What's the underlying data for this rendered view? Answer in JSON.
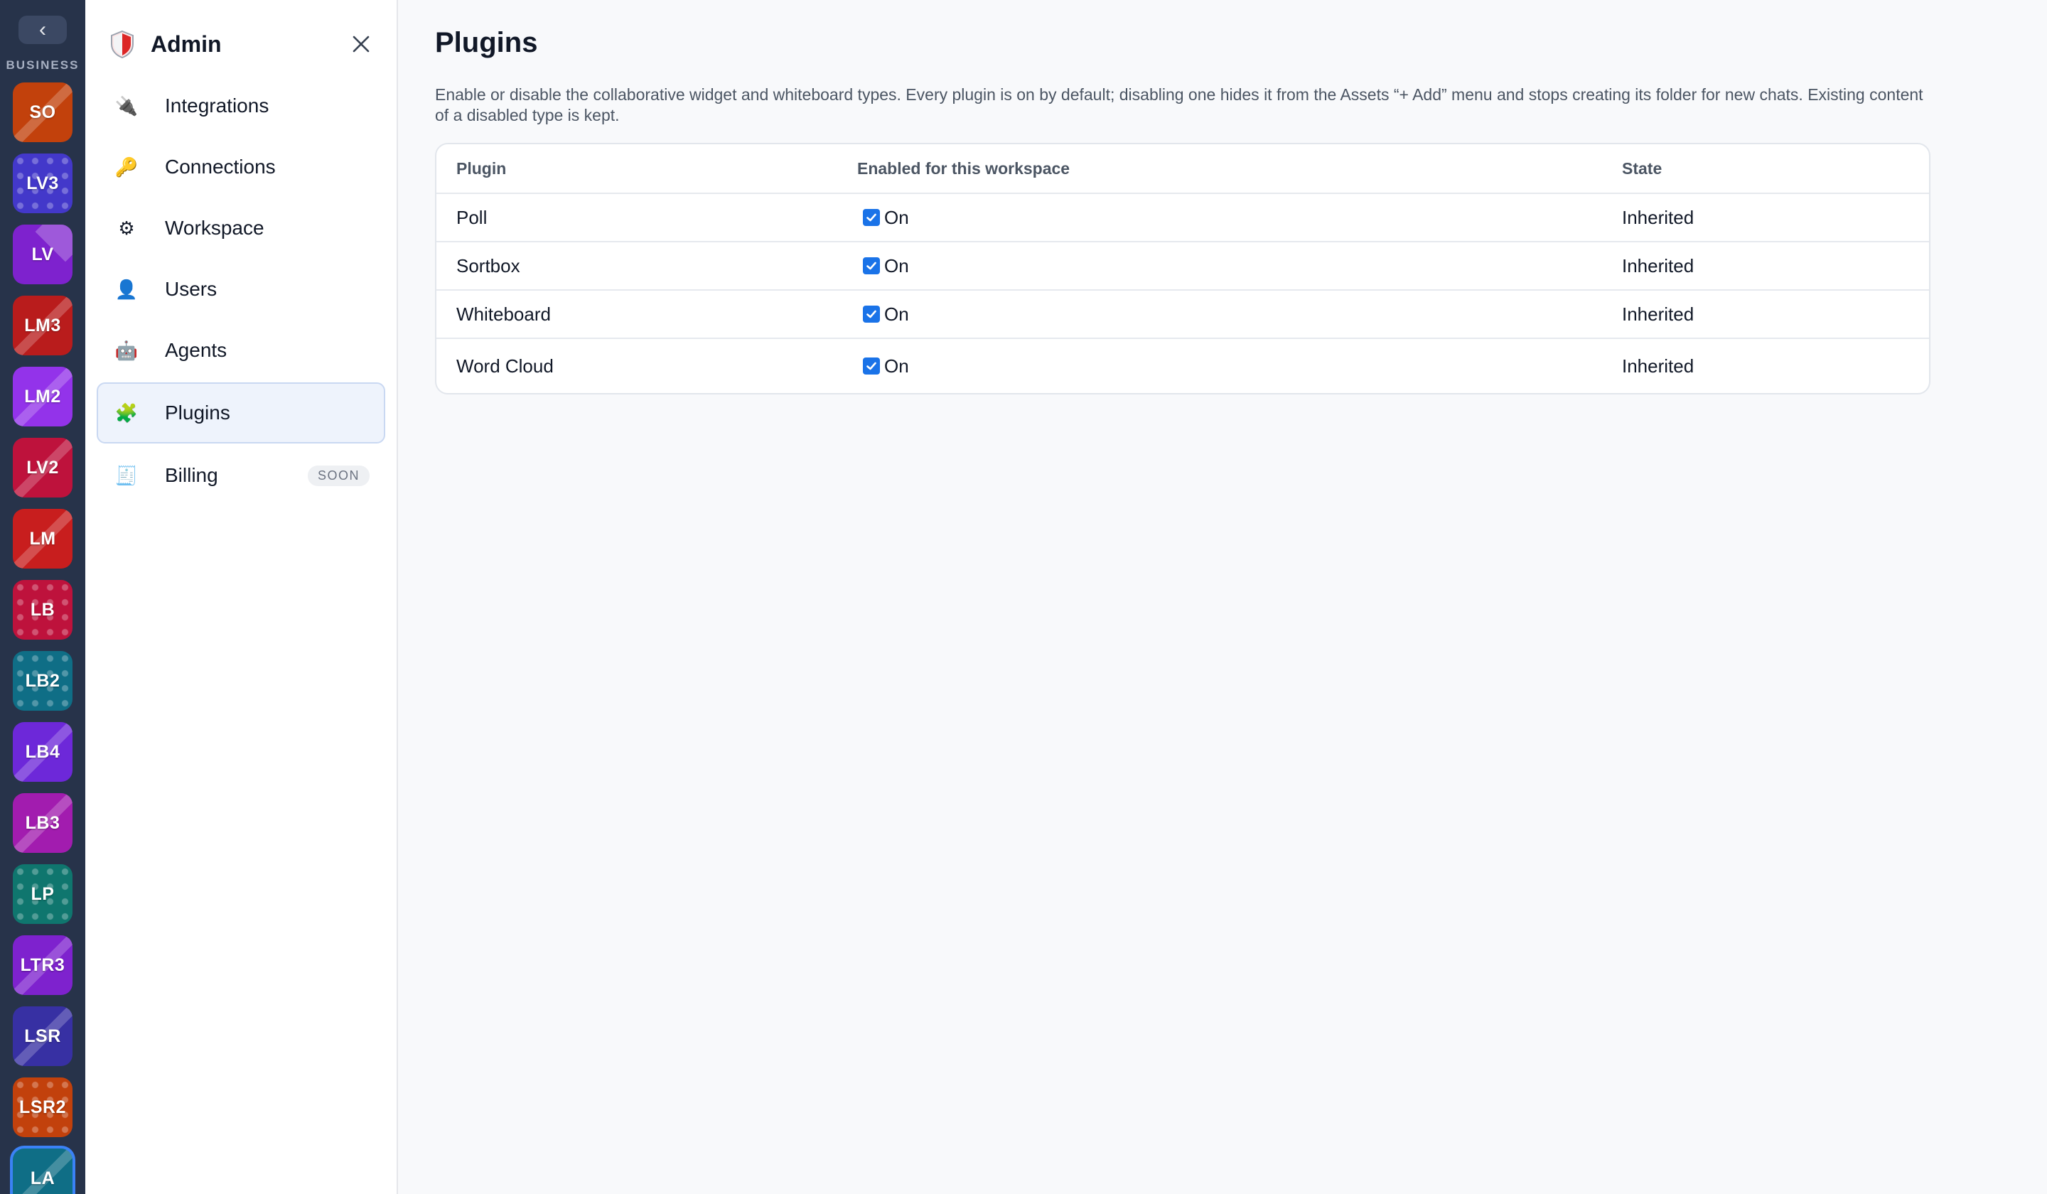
{
  "rail": {
    "back_glyph": "‹",
    "section_label": "BUSINESS",
    "workspaces": [
      {
        "initials": "SO",
        "color": "#c2410c",
        "pattern": "stripe"
      },
      {
        "initials": "LV3",
        "color": "#4338ca",
        "pattern": "dots"
      },
      {
        "initials": "LV",
        "color": "#7e22ce",
        "pattern": "corner"
      },
      {
        "initials": "LM3",
        "color": "#b91c1c",
        "pattern": "stripe"
      },
      {
        "initials": "LM2",
        "color": "#9333ea",
        "pattern": "stripe"
      },
      {
        "initials": "LV2",
        "color": "#be123c",
        "pattern": "stripe"
      },
      {
        "initials": "LM",
        "color": "#c81e1e",
        "pattern": "stripe"
      },
      {
        "initials": "LB",
        "color": "#be123c",
        "pattern": "dots"
      },
      {
        "initials": "LB2",
        "color": "#0f6e86",
        "pattern": "dots"
      },
      {
        "initials": "LB4",
        "color": "#6d28d9",
        "pattern": "stripe"
      },
      {
        "initials": "LB3",
        "color": "#a21caf",
        "pattern": "stripe"
      },
      {
        "initials": "LP",
        "color": "#0f766e",
        "pattern": "dots"
      },
      {
        "initials": "LTR3",
        "color": "#7e22ce",
        "pattern": "stripe"
      },
      {
        "initials": "LSR",
        "color": "#3730a3",
        "pattern": "stripe"
      },
      {
        "initials": "LSR2",
        "color": "#c2410c",
        "pattern": "dots"
      },
      {
        "initials": "LA",
        "color": "#0f6e86",
        "pattern": "stripe",
        "active": true
      }
    ]
  },
  "admin": {
    "title": "Admin",
    "logo_icon": "shield-icon",
    "close_glyph": "✕",
    "nav": [
      {
        "key": "integrations",
        "label": "Integrations",
        "icon": "plug-icon",
        "glyph": "🔌"
      },
      {
        "key": "connections",
        "label": "Connections",
        "icon": "key-icon",
        "glyph": "🔑"
      },
      {
        "key": "workspace",
        "label": "Workspace",
        "icon": "gear-icon",
        "glyph": "⚙"
      },
      {
        "key": "users",
        "label": "Users",
        "icon": "user-icon",
        "glyph": "👤"
      },
      {
        "key": "agents",
        "label": "Agents",
        "icon": "robot-icon",
        "glyph": "🤖"
      },
      {
        "key": "plugins",
        "label": "Plugins",
        "icon": "puzzle-icon",
        "glyph": "🧩",
        "active": true
      },
      {
        "key": "billing",
        "label": "Billing",
        "icon": "receipt-icon",
        "glyph": "🧾",
        "badge": "SOON"
      }
    ]
  },
  "main": {
    "title": "Plugins",
    "description": "Enable or disable the collaborative widget and whiteboard types. Every plugin is on by default; disabling one hides it from the Assets “+ Add” menu and stops creating its folder for new chats. Existing content of a disabled type is kept.",
    "table": {
      "columns": [
        "Plugin",
        "Enabled for this workspace",
        "State"
      ],
      "rows": [
        {
          "plugin": "Poll",
          "enabled": true,
          "enabled_label": "On",
          "state": "Inherited"
        },
        {
          "plugin": "Sortbox",
          "enabled": true,
          "enabled_label": "On",
          "state": "Inherited"
        },
        {
          "plugin": "Whiteboard",
          "enabled": true,
          "enabled_label": "On",
          "state": "Inherited"
        },
        {
          "plugin": "Word Cloud",
          "enabled": true,
          "enabled_label": "On",
          "state": "Inherited"
        }
      ]
    }
  },
  "colors": {
    "rail_bg": "#27334a",
    "accent": "#1a73e8",
    "active_nav_bg": "#eef3fc"
  }
}
